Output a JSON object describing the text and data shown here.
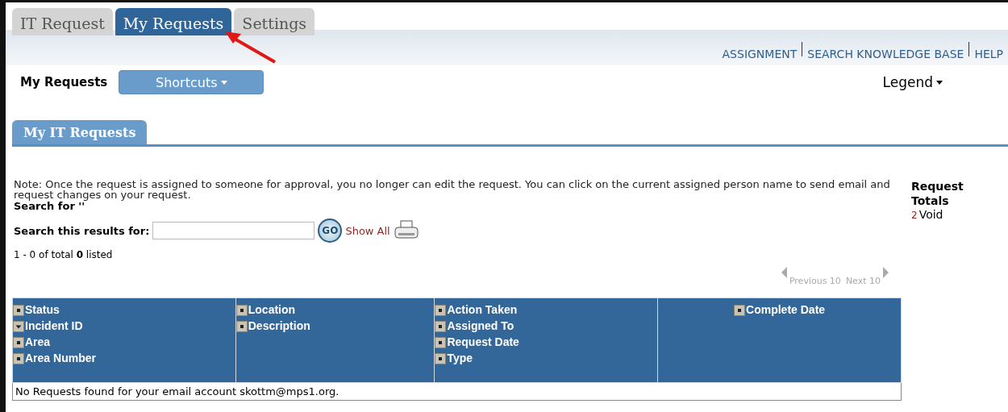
{
  "tabs": [
    {
      "label": "IT Request",
      "selected": false
    },
    {
      "label": "My Requests",
      "selected": true
    },
    {
      "label": "Settings",
      "selected": false
    }
  ],
  "top_links": [
    "ASSIGNMENT",
    "SEARCH KNOWLEDGE BASE",
    "HELP"
  ],
  "toolbar": {
    "title": "My Requests",
    "shortcuts": "Shortcuts",
    "legend": "Legend"
  },
  "section_tab": {
    "label": "My IT Requests",
    "selected": true
  },
  "note": "Note: Once the request is assigned to someone for approval, you no longer can edit the request. You can click on the current assigned person name to send email and request changes on your request.",
  "search_for": "Search for ''",
  "search": {
    "label": "Search this results for:",
    "go": "GO",
    "show_all": "Show All"
  },
  "listed": "1 - 0 of total **0** listed",
  "pager": {
    "previous": "Previous 10",
    "next": "Next 10",
    "disabled": true
  },
  "request_totals": {
    "title": "Request Totals",
    "items": [
      {
        "count": "2",
        "label": "Void"
      }
    ]
  },
  "table": {
    "columns": [
      {
        "fields": [
          {
            "label": "Status",
            "sorted": false
          },
          {
            "label": "Incident ID",
            "sorted": true
          },
          {
            "label": "Area",
            "sorted": false
          },
          {
            "label": "Area Number",
            "sorted": false
          }
        ]
      },
      {
        "fields": [
          {
            "label": "Location",
            "sorted": false
          },
          {
            "label": "Description",
            "sorted": false
          }
        ]
      },
      {
        "fields": [
          {
            "label": "Action Taken",
            "sorted": false
          },
          {
            "label": "Assigned To",
            "sorted": false
          },
          {
            "label": "Request Date",
            "sorted": false
          },
          {
            "label": "Type",
            "sorted": false
          }
        ]
      },
      {
        "fields": [
          {
            "label": "Complete Date",
            "sorted": false
          }
        ]
      }
    ],
    "empty_message": "No Requests found for your email account skottm@mps1.org."
  }
}
